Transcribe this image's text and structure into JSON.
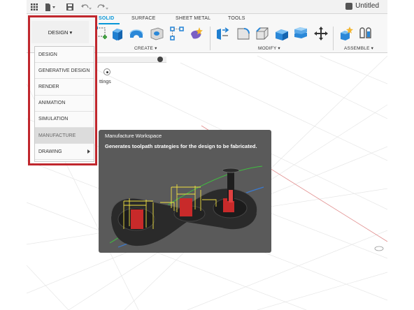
{
  "titlebar": {
    "icons": [
      "apps-grid-icon",
      "file-icon",
      "save-icon",
      "undo-icon",
      "redo-icon"
    ],
    "doc_title": "Untitled"
  },
  "ribbon": {
    "tabs": [
      {
        "label": "SOLID",
        "active": true
      },
      {
        "label": "SURFACE",
        "active": false
      },
      {
        "label": "SHEET METAL",
        "active": false
      },
      {
        "label": "TOOLS",
        "active": false
      }
    ],
    "groups": {
      "create": "CREATE ▾",
      "modify": "MODIFY ▾",
      "assemble": "ASSEMBLE ▾"
    }
  },
  "workspace": {
    "button_label": "DESIGN ▾",
    "menu_items": [
      {
        "label": "DESIGN"
      },
      {
        "label": "GENERATIVE DESIGN"
      },
      {
        "label": "RENDER"
      },
      {
        "label": "ANIMATION"
      },
      {
        "label": "SIMULATION"
      },
      {
        "label": "MANUFACTURE",
        "selected": true
      },
      {
        "label": "DRAWING",
        "submenu": true
      }
    ]
  },
  "browser": {
    "settings_text": "ttings"
  },
  "tooltip": {
    "title": "Manufacture Workspace",
    "description": "Generates toolpath strategies for the design to be fabricated."
  },
  "colors": {
    "accent": "#0696d7",
    "highlight": "#c0272d",
    "tooltip_bg": "#5a5a5a"
  }
}
